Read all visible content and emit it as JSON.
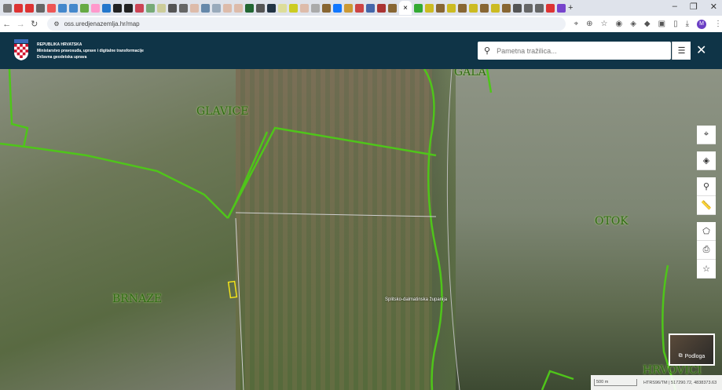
{
  "browser": {
    "url": "oss.uredjenazemlja.hr/map",
    "active_tab_close": "×",
    "new_tab": "+",
    "profile_initial": "M"
  },
  "header": {
    "org_line1": "REPUBLIKA HRVATSKA",
    "org_line2": "Ministarstvo pravosuđa, uprave i digitalne transformacije",
    "org_line3": "Državna geodetska uprava"
  },
  "search": {
    "placeholder": "Pametna tražilica..."
  },
  "map": {
    "places": [
      "GLAVICE",
      "GALA",
      "OTOK",
      "BRNAZE",
      "HRVOVIĆI"
    ],
    "county": "Splitsko-dalmatinska županija"
  },
  "basemap": {
    "label": "Podloga"
  },
  "status": {
    "scale": "500 m",
    "crs": "HTRS96/TM | 517290.72, 4838373.63"
  },
  "colors": {
    "header": "#0f3447",
    "boundary": "#4fc51a"
  }
}
